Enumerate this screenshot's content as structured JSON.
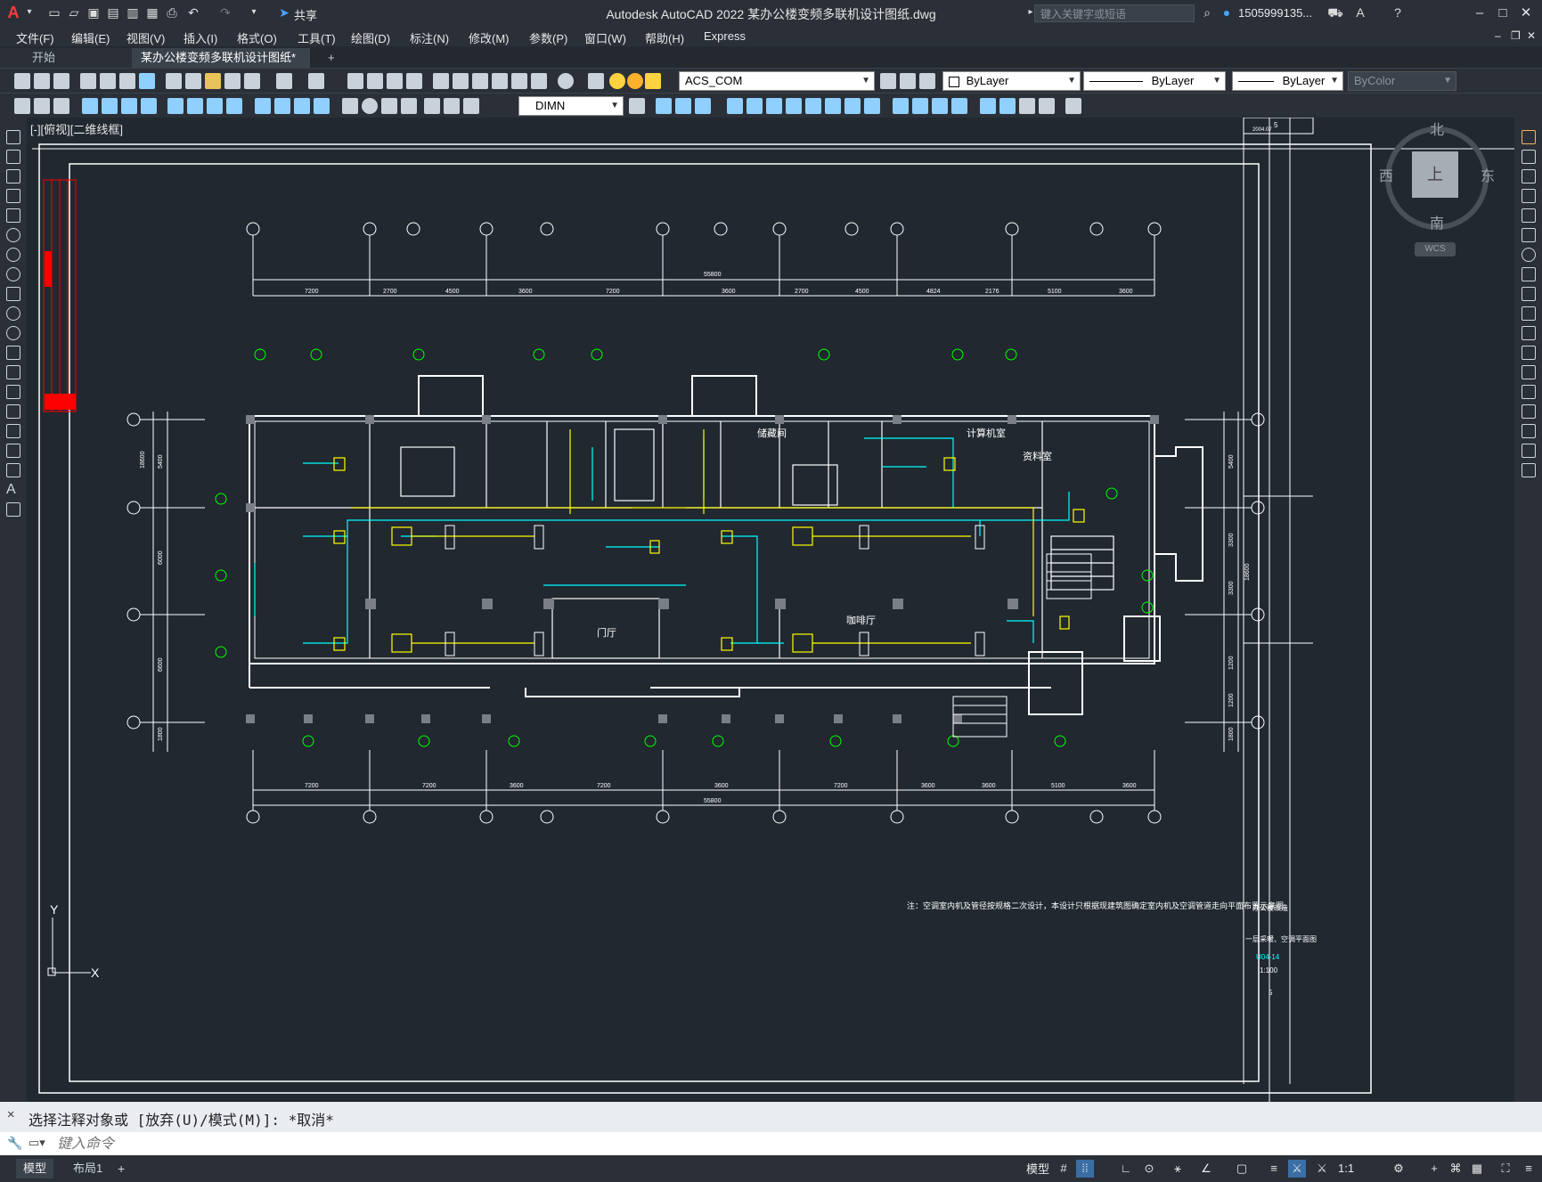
{
  "app": {
    "title": "Autodesk AutoCAD 2022    某办公楼变频多联机设计图纸.dwg",
    "share_label": "共享",
    "search_placeholder": "键入关键字或短语",
    "user_label": "1505999135...",
    "logo_letter": "A"
  },
  "menu": [
    "文件(F)",
    "编辑(E)",
    "视图(V)",
    "插入(I)",
    "格式(O)",
    "工具(T)",
    "绘图(D)",
    "标注(N)",
    "修改(M)",
    "参数(P)",
    "窗口(W)",
    "帮助(H)",
    "Express"
  ],
  "tabs": {
    "start": "开始",
    "drawing": "某办公楼变频多联机设计图纸*",
    "add": "+"
  },
  "toolbar": {
    "layer_value": "ACS_COM",
    "color_value": "ByLayer",
    "linetype_value": "ByLayer",
    "lineweight_value": "ByLayer",
    "plotstyle_value": "ByColor",
    "dimstyle_value": "DIMN"
  },
  "viewport": {
    "label": "[-][俯视][二维线框]"
  },
  "viewcube": {
    "north": "北",
    "south": "南",
    "east": "东",
    "west": "西",
    "top": "上",
    "wcs": "WCS"
  },
  "ucs": {
    "x": "X",
    "y": "Y"
  },
  "drawing": {
    "dims_top": [
      "7200",
      "2700",
      "4500",
      "3600",
      "7200",
      "3600",
      "2700",
      "4500",
      "4824",
      "2176",
      "5100",
      "3600"
    ],
    "dims_top_total": "55800",
    "dims_bottom": [
      "7200",
      "7200",
      "3600",
      "7200",
      "3600",
      "7200",
      "3600",
      "3600",
      "5100",
      "3600"
    ],
    "dims_bottom_total": "55800",
    "dims_left": [
      "5400",
      "6000",
      "6600",
      "1800"
    ],
    "dims_left_total": "18600",
    "dims_right": [
      "5400",
      "3300",
      "3300",
      "1200",
      "1200",
      "1800"
    ],
    "dims_right_total": "18600",
    "rooms": [
      "计算机室",
      "资料室",
      "储藏间",
      "咖啡厅",
      "门厅"
    ],
    "note": "注：空调室内机及管径按规格二次设计，本设计只根据现建筑图确定室内机及空调管道走向平面布置示意图。",
    "titleblock": {
      "project": "办公楼改造",
      "sheet_title": "一层采暖、空调平面图",
      "drawing_no": "U04-14",
      "scale": "1:100",
      "sheet": "5",
      "date": "2004.07"
    }
  },
  "command": {
    "history": "选择注释对象或 [放弃(U)/模式(M)]: *取消*",
    "input_placeholder": "键入命令"
  },
  "statusbar": {
    "model_tab": "模型",
    "layout_tab": "布局1",
    "add_tab": "+",
    "model_space": "模型",
    "scale": "1:1"
  },
  "colors": {
    "bg": "#212830",
    "wall": "#ffffff",
    "duct": "#ffff00",
    "pipe": "#00ffff",
    "axis": "#00ff00",
    "red": "#ff0000"
  }
}
